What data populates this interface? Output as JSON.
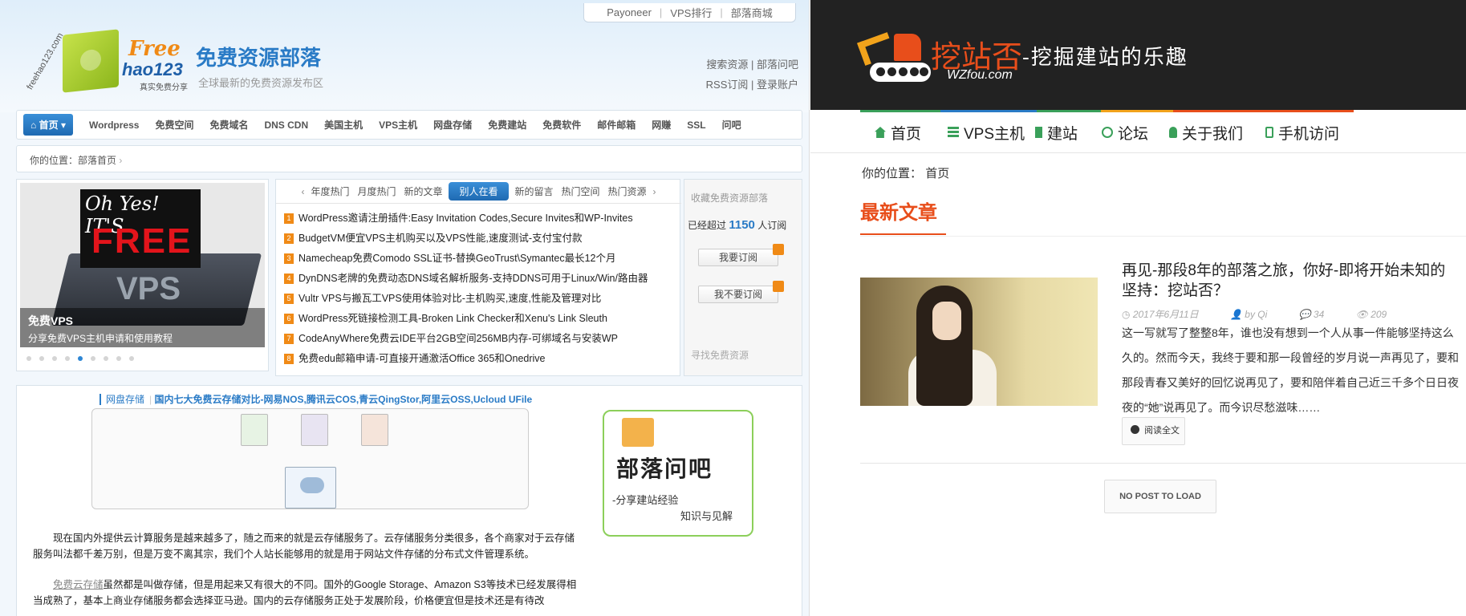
{
  "left": {
    "toplinks": [
      "Payoneer",
      "VPS排行",
      "部落商城"
    ],
    "logo": {
      "arc": "freehao123.com",
      "free": "Free",
      "hao": "hao123",
      "slogan": "真实免费分享"
    },
    "site_title": "免费资源部落",
    "site_desc": "全球最新的免费资源发布区",
    "header_links": {
      "search": "搜索资源",
      "ask": "部落问吧",
      "rss": "RSS订阅",
      "login": "登录账户"
    },
    "nav": {
      "home": "首页",
      "items": [
        "Wordpress",
        "免费空间",
        "免费域名",
        "DNS CDN",
        "美国主机",
        "VPS主机",
        "网盘存储",
        "免费建站",
        "免费软件",
        "邮件邮箱",
        "网赚",
        "SSL",
        "问吧"
      ]
    },
    "breadcrumb": {
      "prefix": "你的位置：",
      "current": "部落首页"
    },
    "slider": {
      "oh_yes": "Oh Yes! IT'S",
      "free": "FREE",
      "server_text": "VPS",
      "caption_title": "免费VPS",
      "caption_sub": "分享免费VPS主机申请和使用教程",
      "dots_total": 9,
      "active_dot": 5
    },
    "hot": {
      "tabs": [
        "年度热门",
        "月度热门",
        "新的文章",
        "别人在看",
        "新的留言",
        "热门空间",
        "热门资源"
      ],
      "active_tab": "别人在看",
      "items": [
        "WordPress邀请注册插件:Easy Invitation Codes,Secure Invites和WP-Invites",
        "BudgetVM便宜VPS主机购买以及VPS性能,速度测试-支付宝付款",
        "Namecheap免费Comodo SSL证书-替换GeoTrust\\Symantec最长12个月",
        "DynDNS老牌的免费动态DNS域名解析服务-支持DDNS可用于Linux/Win/路由器",
        "Vultr VPS与搬瓦工VPS使用体验对比-主机购买,速度,性能及管理对比",
        "WordPress死链接检测工具-Broken Link Checker和Xenu's Link Sleuth",
        "CodeAnyWhere免费云IDE平台2GB空间256MB内存-可绑域名与安装WP",
        "免费edu邮箱申请-可直接开通激活Office 365和Onedrive"
      ]
    },
    "subscribe": {
      "title": "收藏免费资源部落",
      "count_prefix": "已经超过",
      "count": "1150",
      "count_suffix": "人订阅",
      "subscribe_btn": "我要订阅",
      "unsubscribe_btn": "我不要订阅",
      "search_title": "寻找免费资源"
    },
    "article": {
      "category": "网盘存储",
      "title": "国内七大免费云存储对比-网易NOS,腾讯云COS,青云QingStor,阿里云OSS,Ucloud UFile",
      "banner_title": "部落问吧",
      "banner_sub1": "-分享建站经验",
      "banner_sub2": "知识与见解",
      "para1": "现在国内外提供云计算服务是越来越多了，随之而来的就是云存储服务了。云存储服务分类很多，各个商家对于云存储服务叫法都千差万别，但是万变不离其宗，我们个人站长能够用的就是用于网站文件存储的分布式文件管理系统。",
      "para2_link": "免费云存储",
      "para2": "虽然都是叫做存储，但是用起来又有很大的不同。国外的Google Storage、Amazon S3等技术已经发展得相当成熟了，基本上商业存储服务都会选择亚马逊。国内的云存储服务正处于发展阶段，价格便宜但是技术还是有待改"
    }
  },
  "right": {
    "logo_title": "挖站否",
    "logo_subtitle": "-挖掘建站的乐趣",
    "logo_domain": "WZfou.com",
    "nav": [
      "首页",
      "VPS主机",
      "建站",
      "论坛",
      "关于我们",
      "手机访问"
    ],
    "nav_colors": [
      "#3aa05a",
      "#2a7bc6",
      "#3aa05a",
      "#f2a31b",
      "#e84e1b"
    ],
    "breadcrumb": {
      "prefix": "你的位置：",
      "current": "首页"
    },
    "section_title": "最新文章",
    "post": {
      "title": "再见-那段8年的部落之旅，你好-即将开始未知的坚持：挖站否？",
      "date": "2017年6月11日",
      "author": "by Qi",
      "comments": "34",
      "views": "209",
      "excerpt": "这一写就写了整整8年，谁也没有想到一个人从事一件能够坚持这么久的。然而今天，我终于要和那一段曾经的岁月说一声再见了，要和那段青春又美好的回忆说再见了，要和陪伴着自己近三千多个日日夜夜的“她”说再见了。而今识尽愁滋味……",
      "read_more": "阅读全文"
    },
    "load_more": "NO POST TO LOAD"
  }
}
